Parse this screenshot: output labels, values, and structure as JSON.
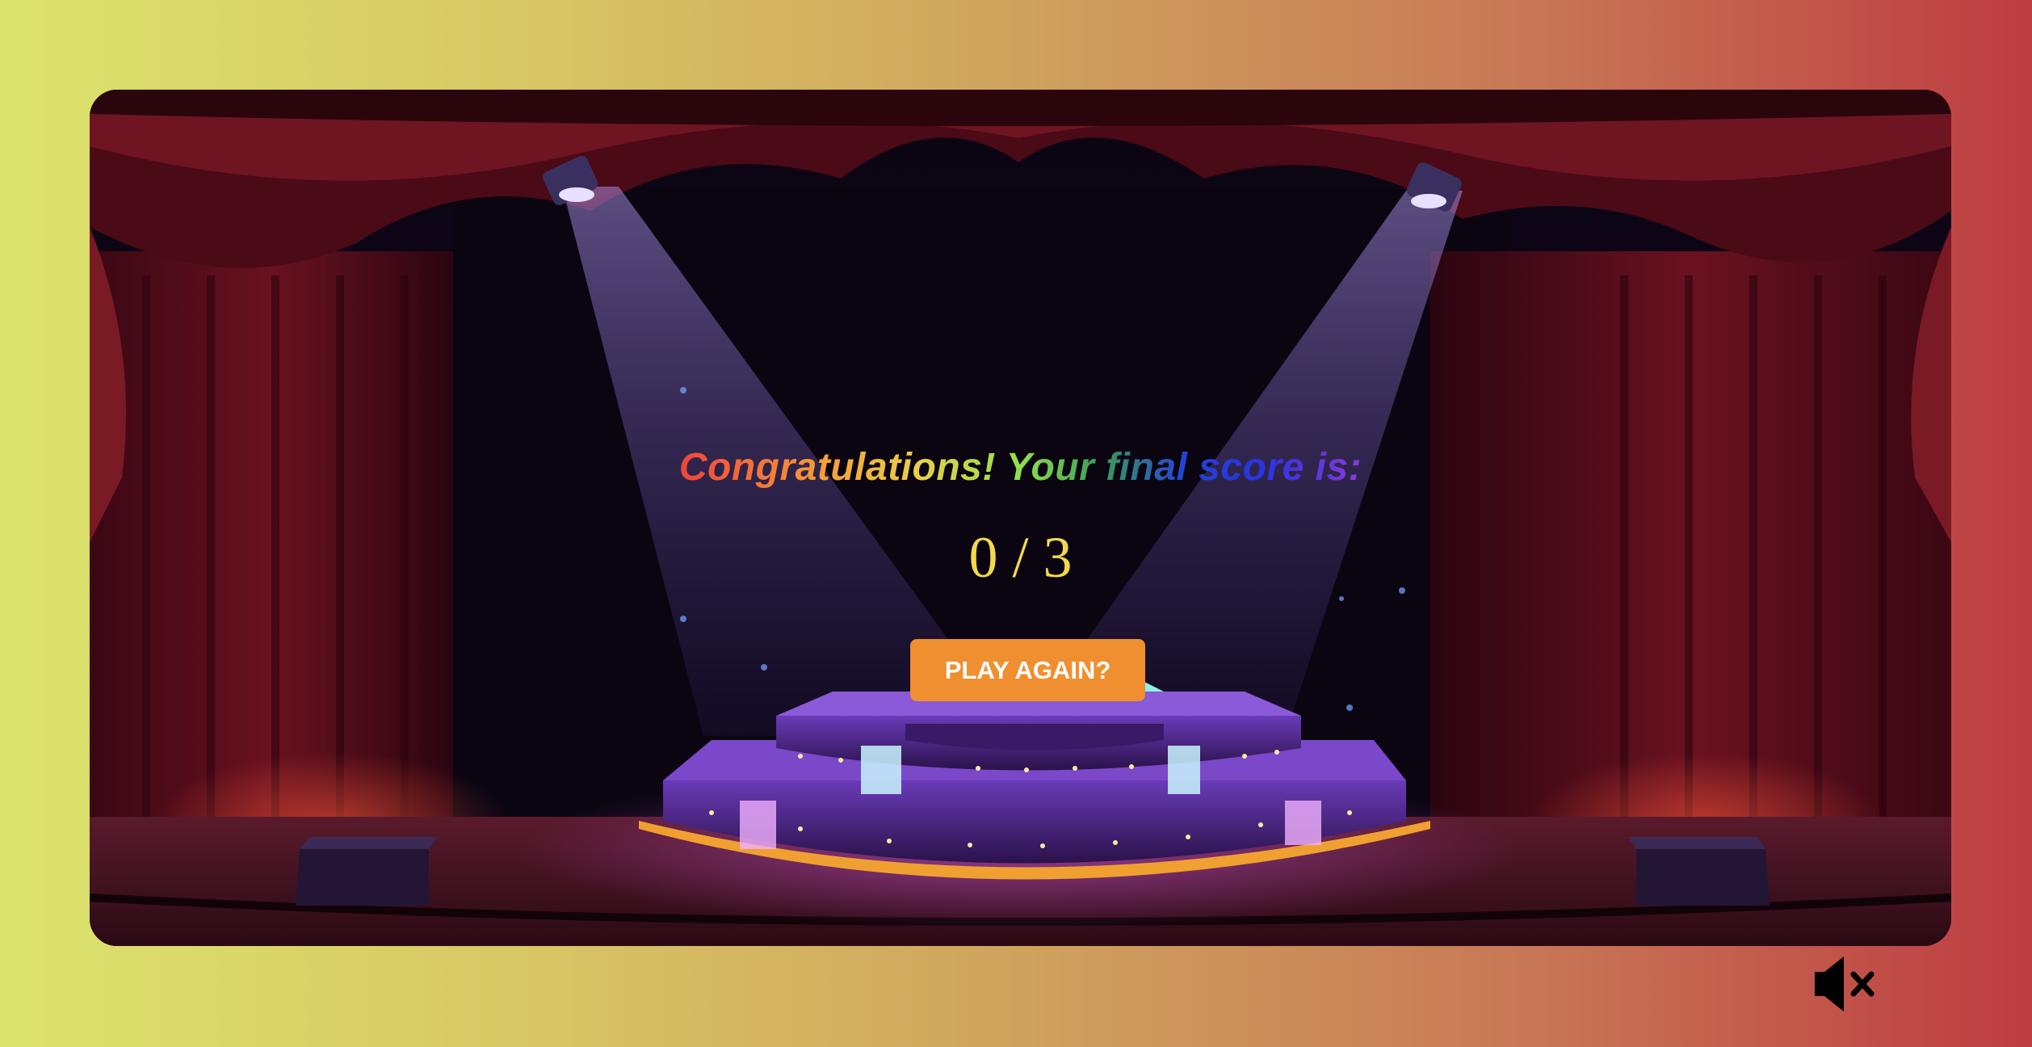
{
  "game": {
    "title": "Congratulations! Your final score is:",
    "score": "0 / 3",
    "play_again_label": "PLAY AGAIN?",
    "sound_state": "muted"
  },
  "icons": {
    "mute": "speaker-muted-icon"
  },
  "colors": {
    "score": "#f2d84c",
    "button": "#ef8f2f",
    "background_left": "#dbe36c",
    "background_right": "#bd3c41"
  }
}
